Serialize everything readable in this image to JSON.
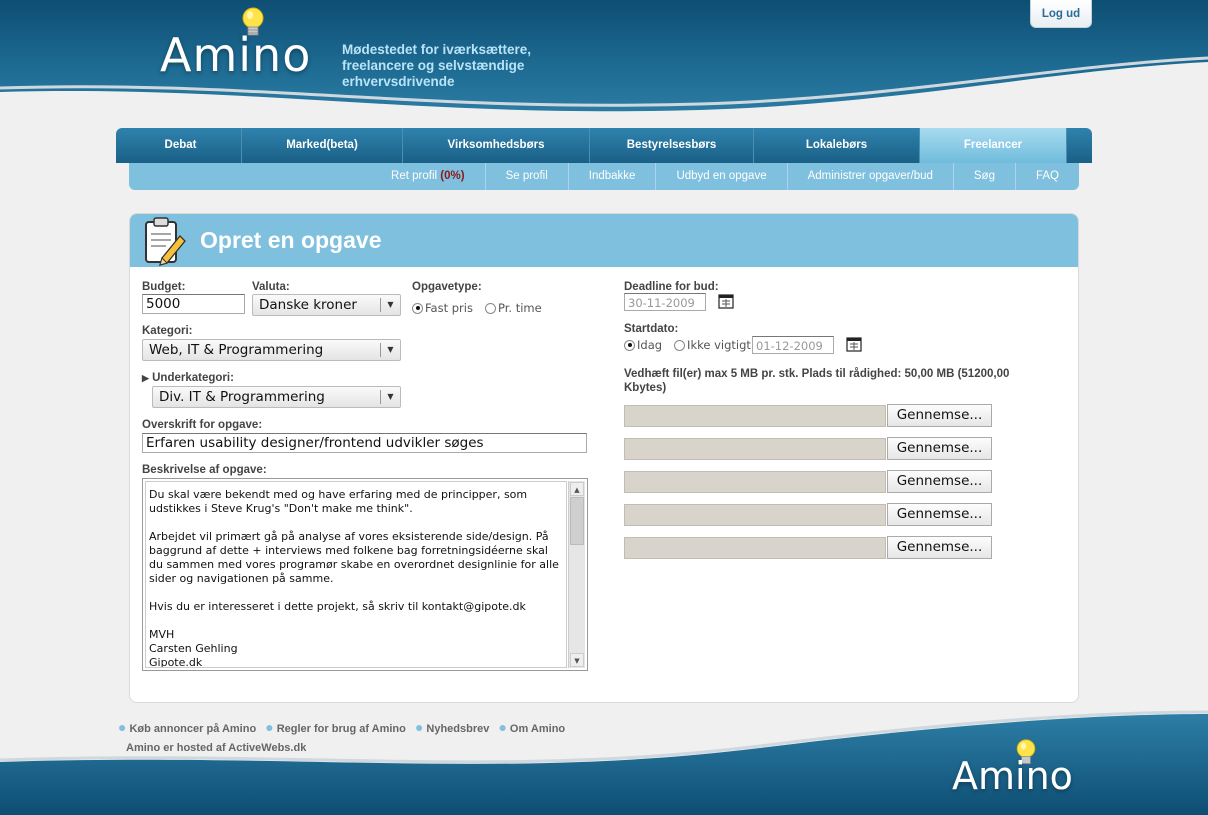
{
  "header": {
    "logo": "Amino",
    "tagline": "Mødestedet for iværksættere, freelancere og selvstændige erhvervsdrivende",
    "logout": "Log ud"
  },
  "nav": {
    "tabs": [
      {
        "label": "Debat"
      },
      {
        "label": "Marked(beta)"
      },
      {
        "label": "Virksomhedsbørs"
      },
      {
        "label": "Bestyrelsesbørs"
      },
      {
        "label": "Lokalebørs"
      },
      {
        "label": "Freelancer",
        "active": true
      }
    ],
    "sub": {
      "edit_profile": "Ret profil",
      "edit_profile_pct": "(0%)",
      "items": [
        "Se profil",
        "Indbakke",
        "Udbyd en opgave",
        "Administrer opgaver/bud",
        "Søg",
        "FAQ"
      ]
    }
  },
  "form": {
    "title": "Opret en opgave",
    "budget_label": "Budget:",
    "budget_value": "5000",
    "currency_label": "Valuta:",
    "currency_value": "Danske kroner",
    "type_label": "Opgavetype:",
    "type_fixed": "Fast pris",
    "type_hourly": "Pr. time",
    "category_label": "Kategori:",
    "category_value": "Web, IT & Programmering",
    "subcategory_label": "Underkategori:",
    "subcategory_value": "Div. IT & Programmering",
    "heading_label": "Overskrift for opgave:",
    "heading_value": "Erfaren usability designer/frontend udvikler søges",
    "description_label": "Beskrivelse af opgave:",
    "description_paragraphs": [
      "Du skal være bekendt med og have erfaring med de principper, som udstikkes i Steve Krug's \"Don't make me think\".",
      "Arbejdet vil primært gå på analyse af vores eksisterende side/design. På baggrund af dette + interviews med folkene bag forretningsidéerne skal du sammen med vores programør skabe en overordnet designlinie for alle sider og navigationen på samme.",
      "Hvis du er interesseret i dette projekt, så skriv til kontakt@gipote.dk",
      "MVH\nCarsten Gehling\nGipote.dk"
    ],
    "deadline_label": "Deadline for bud:",
    "deadline_value": "30-11-2009",
    "start_label": "Startdato:",
    "start_today": "Idag",
    "start_not_important": "Ikke vigtigt",
    "start_value": "01-12-2009",
    "attach_label": "Vedhæft fil(er) max 5 MB pr. stk. Plads til rådighed: 50,00 MB (51200,00 Kbytes)",
    "browse_label": "Gennemse..."
  },
  "footer": {
    "links": [
      "Køb annoncer på Amino",
      "Regler for brug af Amino",
      "Nyhedsbrev",
      "Om Amino"
    ],
    "hosted": "Amino er hosted af ActiveWebs.dk",
    "logo": "Amino"
  },
  "colors": {
    "header_dark": "#0e4e73",
    "nav_blue": "#1a5f86",
    "sub_blue": "#7fc0de",
    "active_tab": "#8fcfe8"
  }
}
